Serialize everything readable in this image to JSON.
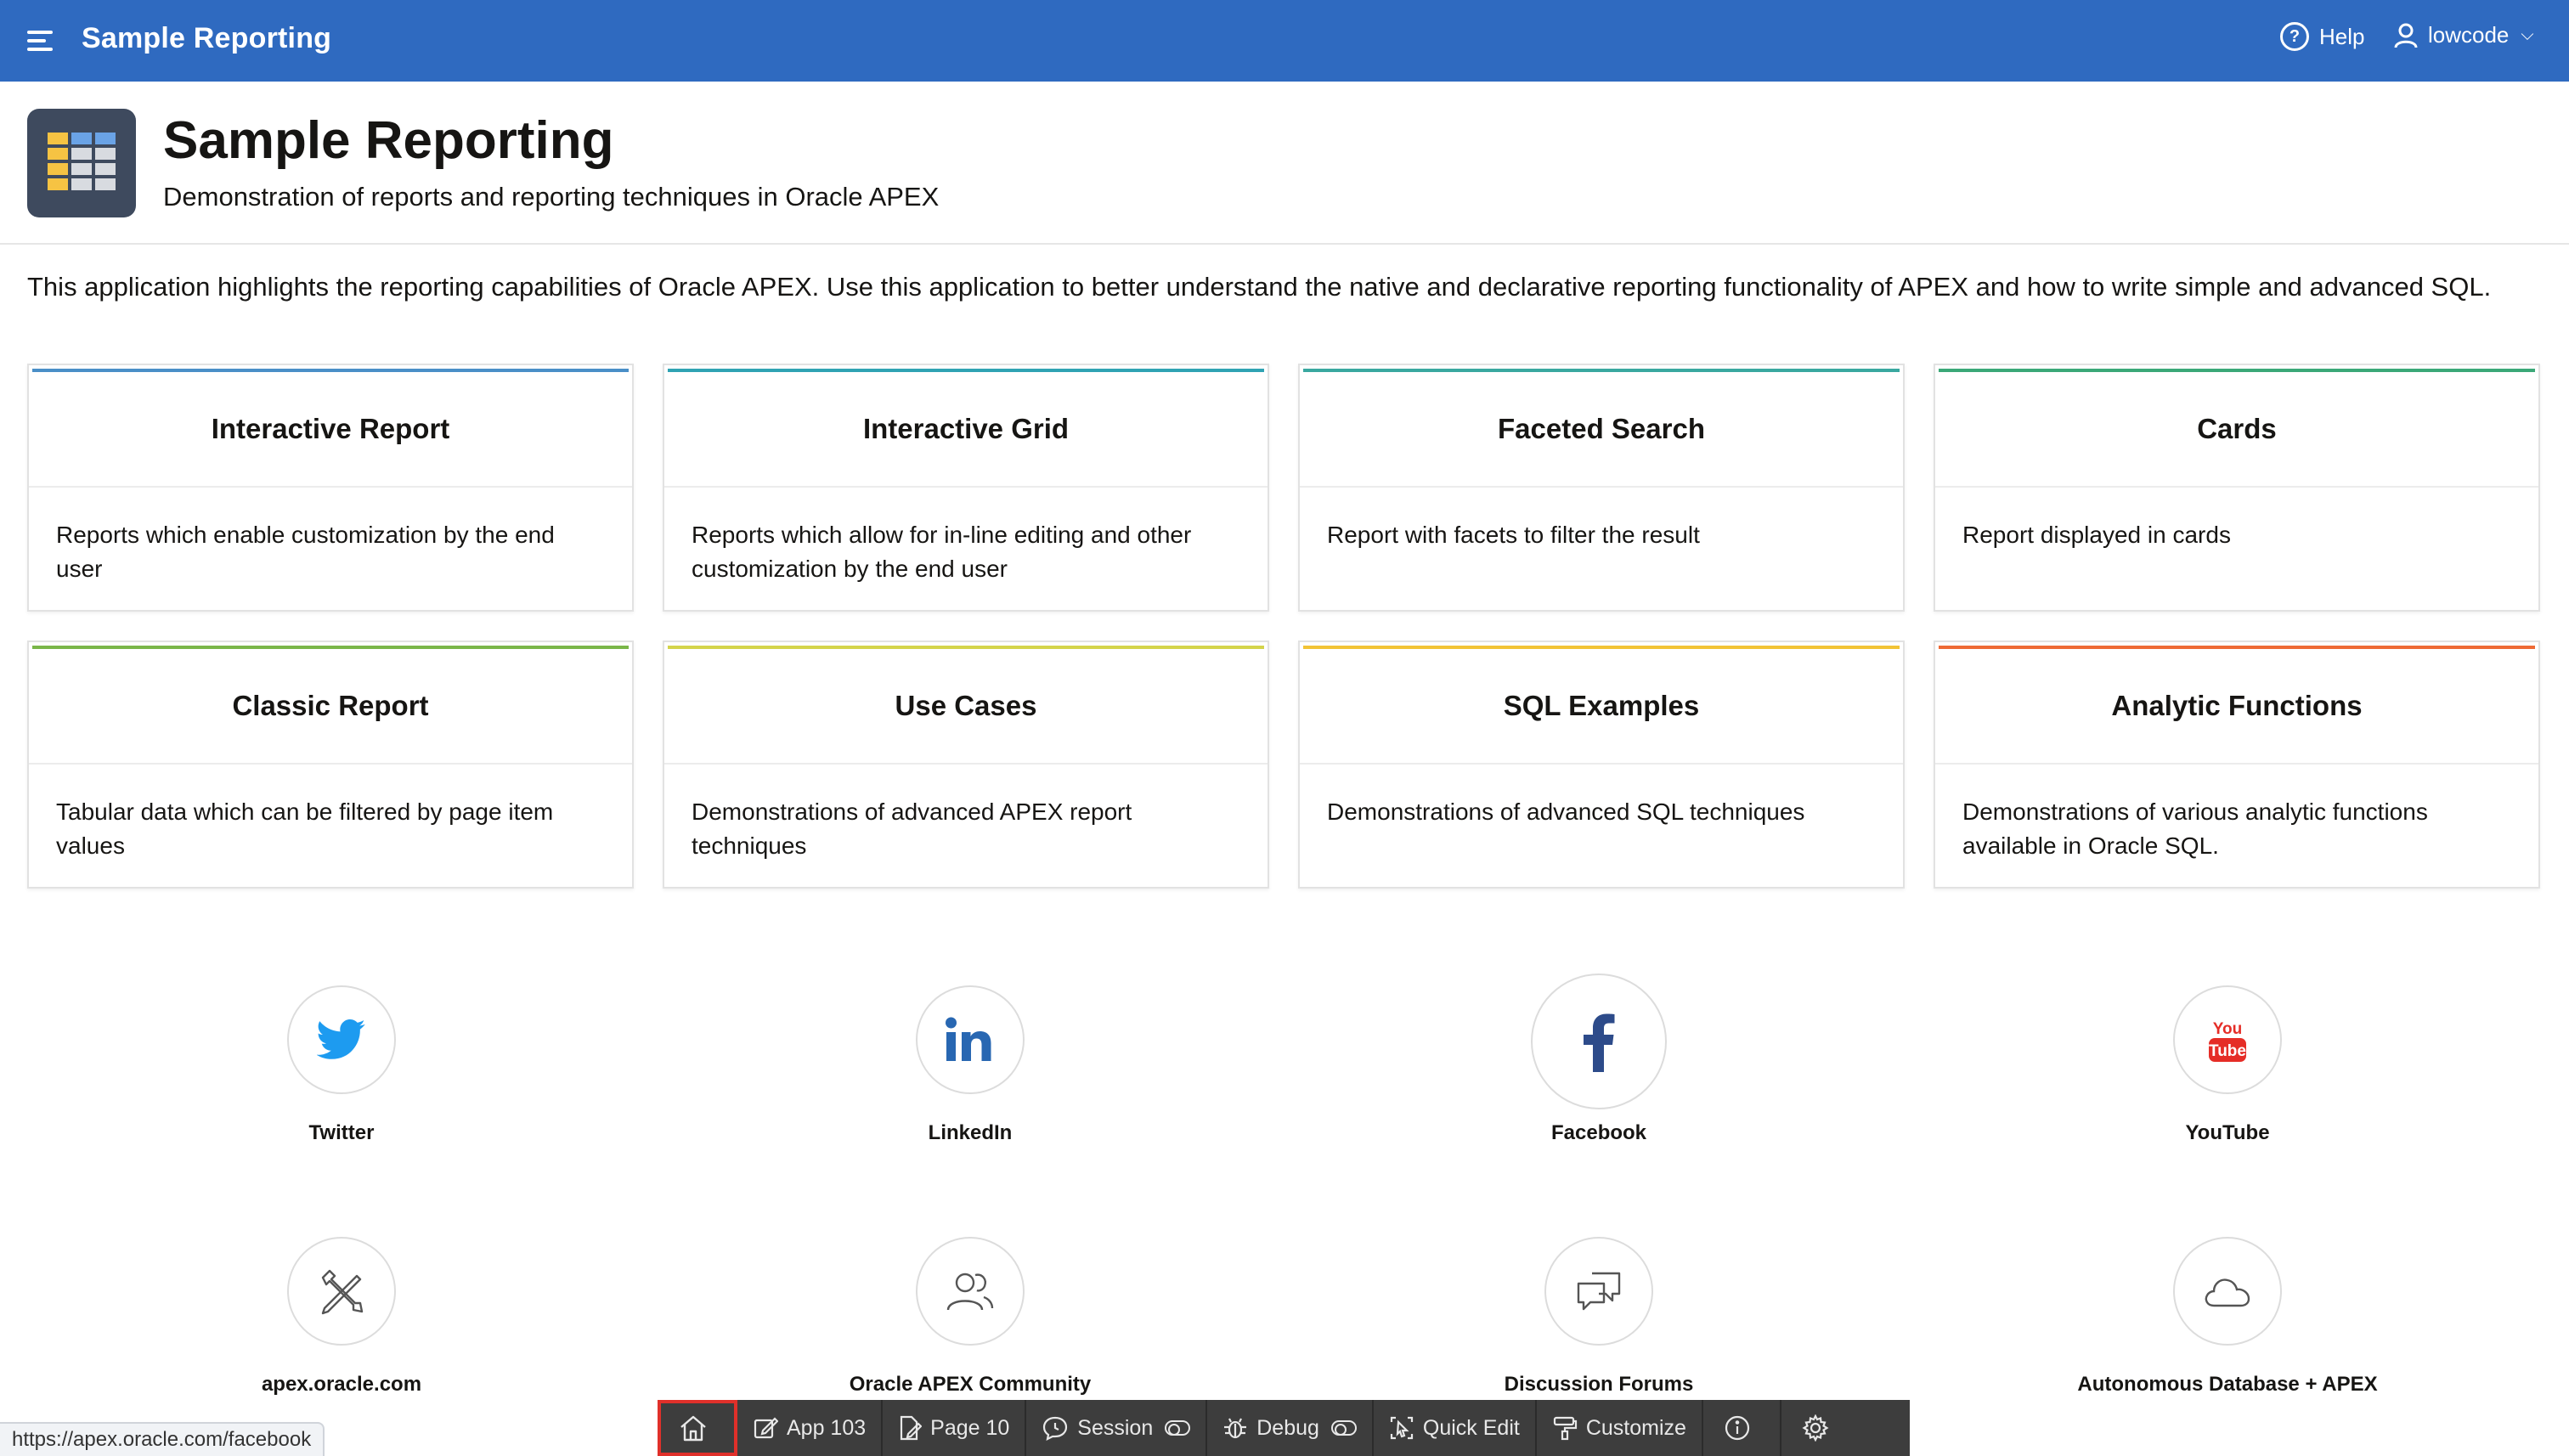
{
  "header": {
    "app_title": "Sample Reporting",
    "help_label": "Help",
    "help_glyph": "?",
    "user_label": "lowcode",
    "user_chevron": "⌵"
  },
  "hero": {
    "title": "Sample Reporting",
    "subtitle": "Demonstration of reports and reporting techniques in Oracle APEX"
  },
  "intro": "This application highlights the reporting capabilities of Oracle APEX. Use this application to better understand the native and declarative reporting functionality of APEX and how to write simple and advanced SQL.",
  "cards": [
    {
      "title": "Interactive Report",
      "desc": "Reports which enable customization by the end user",
      "accent": "#4a8fc7"
    },
    {
      "title": "Interactive Grid",
      "desc": "Reports which allow for in-line editing and other customization by the end user",
      "accent": "#2fa3b3"
    },
    {
      "title": "Faceted Search",
      "desc": "Report with facets to filter the result",
      "accent": "#3aa8a0"
    },
    {
      "title": "Cards",
      "desc": "Report displayed in cards",
      "accent": "#3ba878"
    },
    {
      "title": "Classic Report",
      "desc": "Tabular data which can be filtered by page item values",
      "accent": "#7ab648"
    },
    {
      "title": "Use Cases",
      "desc": "Demonstrations of advanced APEX report techniques",
      "accent": "#d4d44a"
    },
    {
      "title": "SQL Examples",
      "desc": "Demonstrations of advanced SQL techniques",
      "accent": "#f2c335"
    },
    {
      "title": "Analytic Functions",
      "desc": "Demonstrations of various analytic functions available in Oracle SQL.",
      "accent": "#ee6a35"
    }
  ],
  "links": [
    {
      "label": "Twitter",
      "icon": "twitter-icon"
    },
    {
      "label": "LinkedIn",
      "icon": "linkedin-icon"
    },
    {
      "label": "Facebook",
      "icon": "facebook-icon"
    },
    {
      "label": "YouTube",
      "icon": "youtube-icon"
    },
    {
      "label": "apex.oracle.com",
      "icon": "tools-icon"
    },
    {
      "label": "Oracle APEX Community",
      "icon": "community-icon"
    },
    {
      "label": "Discussion Forums",
      "icon": "chat-icon"
    },
    {
      "label": "Autonomous Database + APEX",
      "icon": "cloud-icon"
    }
  ],
  "status_url": "https://apex.oracle.com/facebook",
  "devbar": {
    "app": "App 103",
    "page": "Page 10",
    "session": "Session",
    "debug": "Debug",
    "quick_edit": "Quick Edit",
    "customize": "Customize"
  },
  "colors": {
    "header": "#2f6ac0",
    "linkedin": "#2867b2",
    "twitter": "#1d9bf0",
    "facebook": "#2d4b8a",
    "youtube": "#e52d27"
  }
}
